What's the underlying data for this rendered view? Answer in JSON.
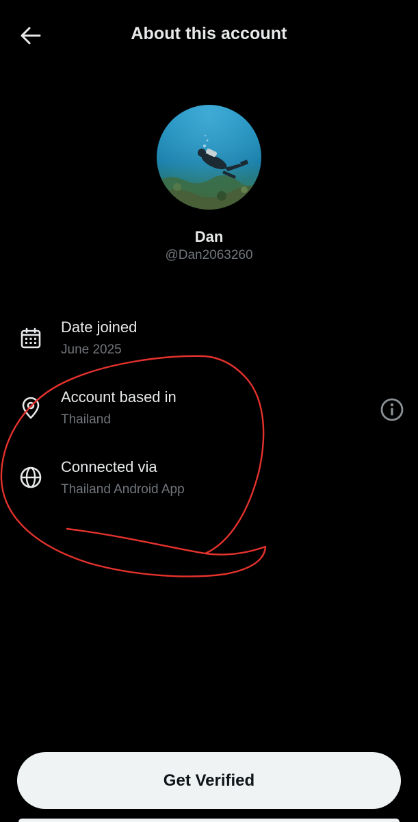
{
  "header": {
    "title": "About this account",
    "back_icon": "arrow-left-icon"
  },
  "profile": {
    "display_name": "Dan",
    "handle": "@Dan2063260",
    "avatar": "scuba-diver-photo"
  },
  "info_rows": [
    {
      "icon": "calendar-icon",
      "label": "Date joined",
      "value": "June 2025"
    },
    {
      "icon": "location-pin-icon",
      "label": "Account based in",
      "value": "Thailand"
    },
    {
      "icon": "globe-icon",
      "label": "Connected via",
      "value": "Thailand Android App"
    }
  ],
  "help_icon": "info-circle-icon",
  "cta": {
    "label": "Get Verified"
  },
  "colors": {
    "background": "#000000",
    "primary_text": "#e7e9ea",
    "secondary_text": "#71767b",
    "button_bg": "#eff3f4",
    "button_text": "#0f1419",
    "annotation": "#e5322d"
  }
}
